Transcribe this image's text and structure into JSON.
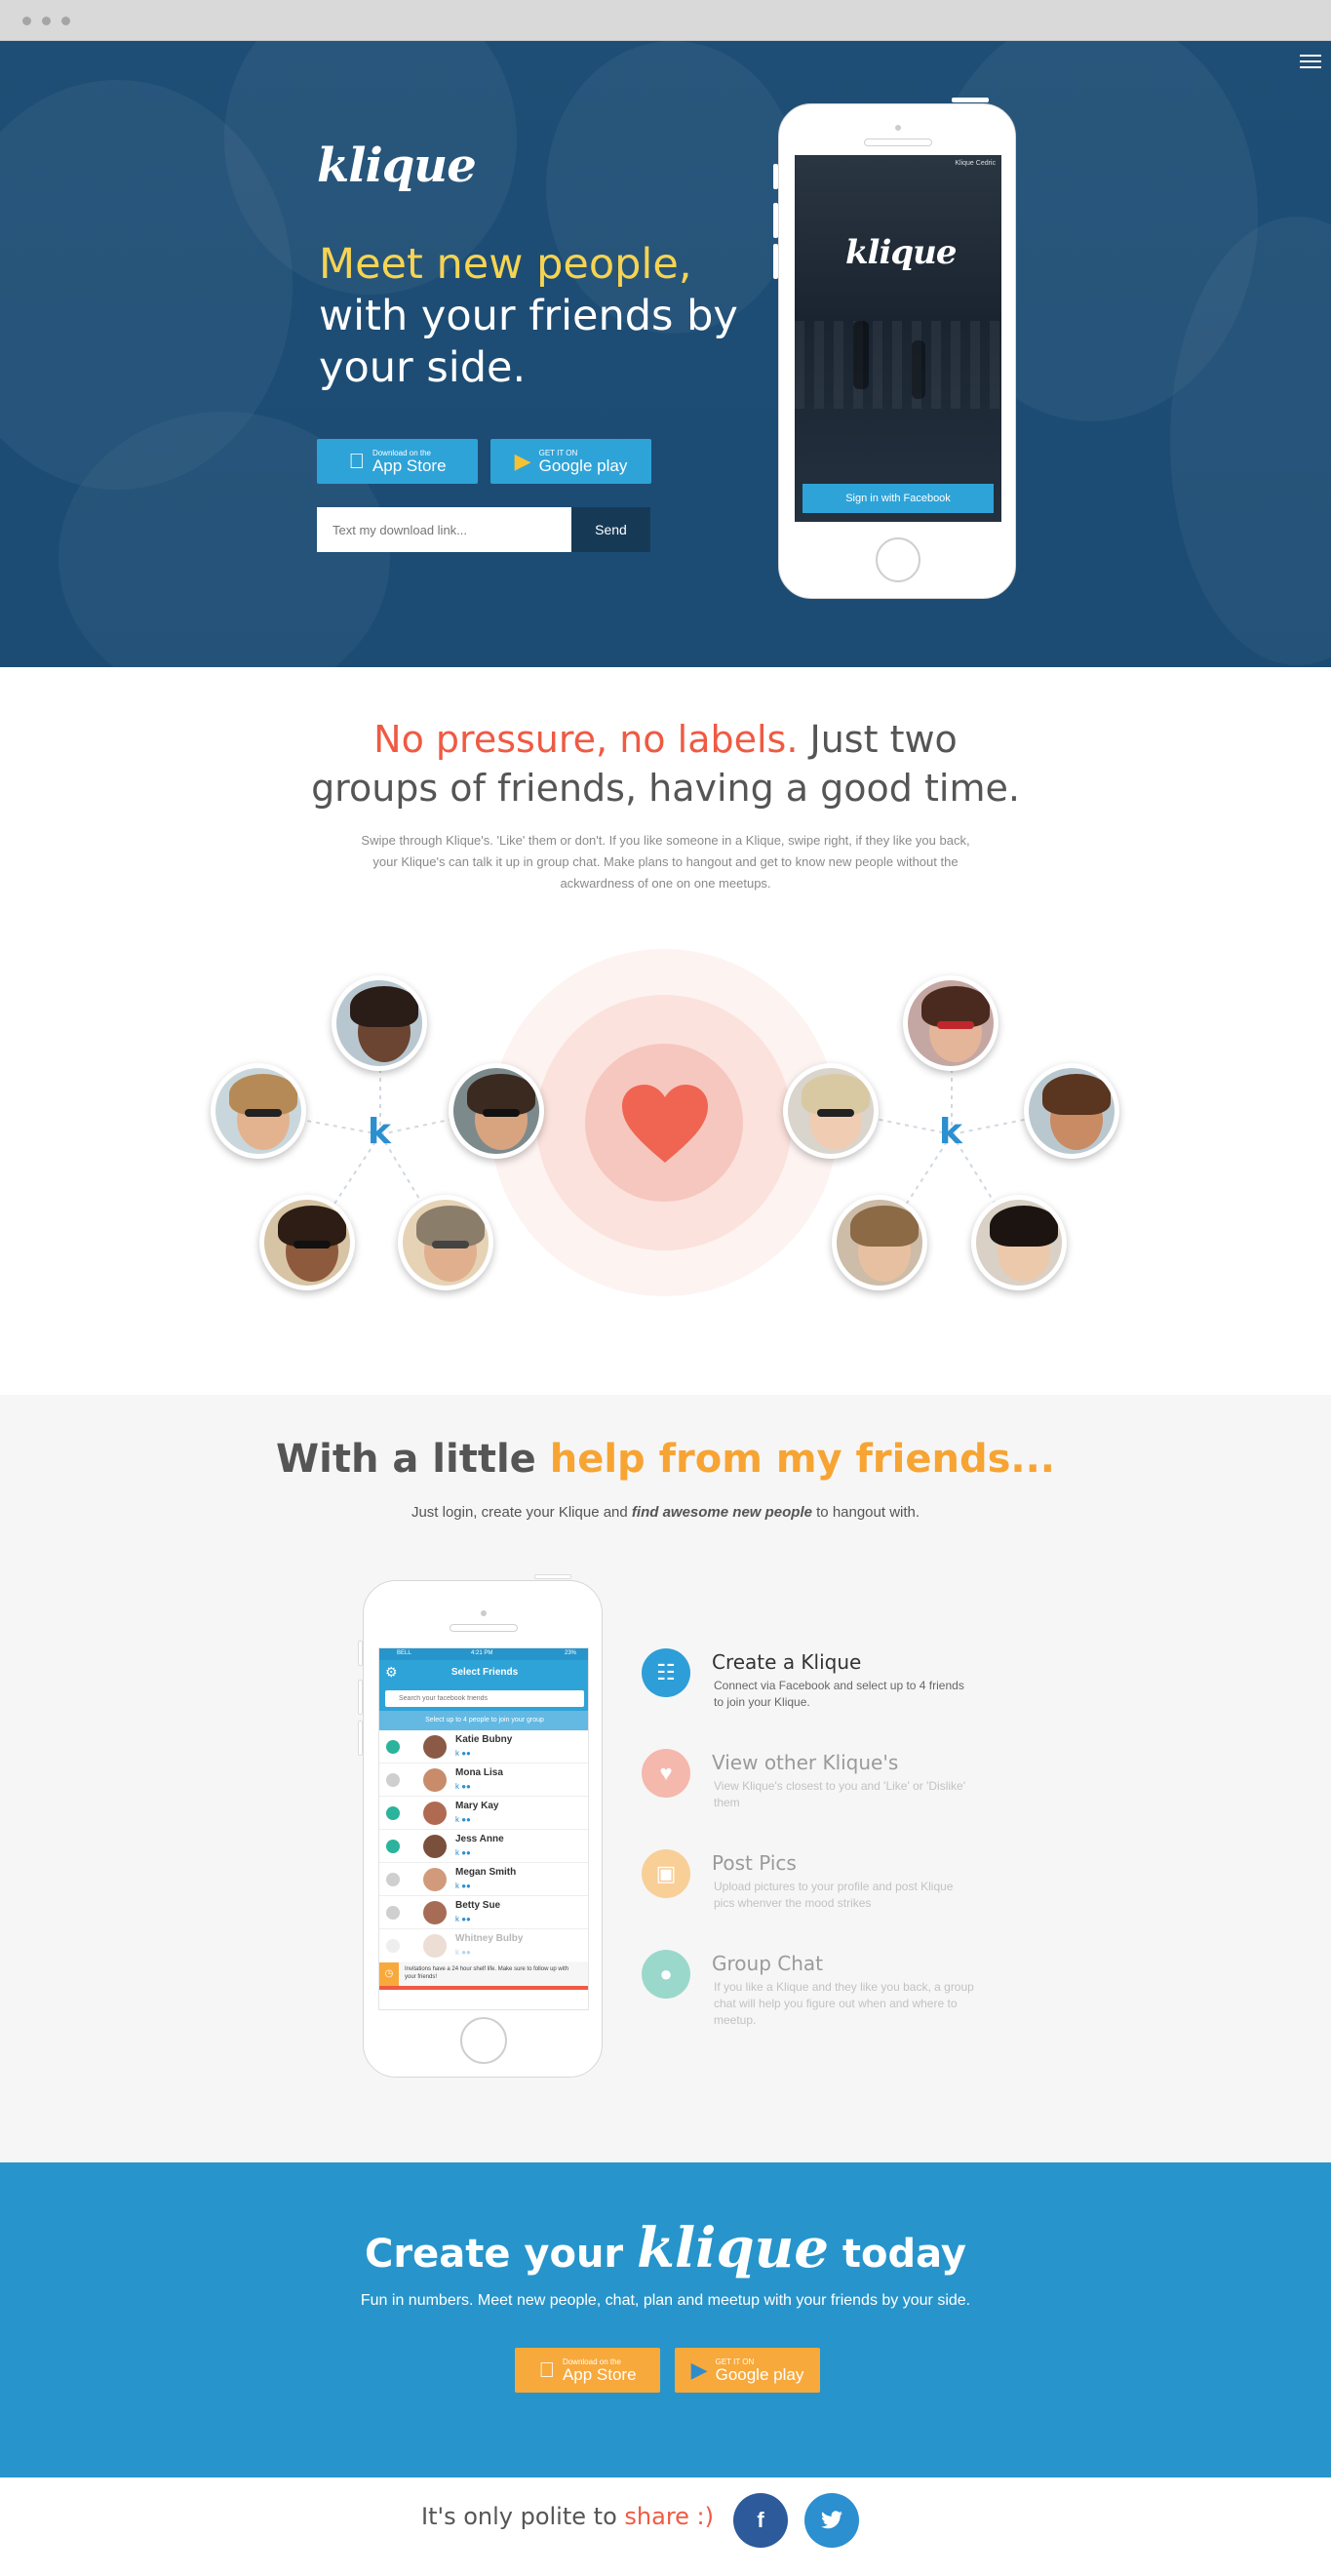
{
  "hero": {
    "logo": "klique",
    "headline_highlight": "Meet new people,",
    "headline_rest": "with your friends by your side.",
    "appstore_small": "Download on the",
    "appstore_large": "App Store",
    "googleplay_small": "GET IT ON",
    "googleplay_large": "Google play",
    "input_placeholder": "Text my download link...",
    "send_label": "Send",
    "phone": {
      "status_text": "Klique Cedric",
      "logo": "klique",
      "fb_button": "Sign in with Facebook"
    }
  },
  "intro": {
    "title_red": "No pressure, no labels.",
    "title_rest_1": "Just two",
    "title_rest_2": "groups of friends, having a good time.",
    "paragraph": "Swipe through Klique's. 'Like' them or don't.  If you like someone in a Klique, swipe right, if they like you back, your Klique's can talk it up in group chat.  Make plans to hangout and get to know new people without the ackwardness of one on one meetups.",
    "klique_mark": "k"
  },
  "features": {
    "title_plain": "With a little",
    "title_orange": "help from my friends...",
    "subtitle_before": "Just login, create your Klique and",
    "subtitle_bold": "find awesome new people",
    "subtitle_after": "to hangout with.",
    "items": [
      {
        "title": "Create a Klique",
        "desc": "Connect via Facebook and select up to 4 friends to join your Klique.",
        "icon": "group-icon",
        "color": "#2d9ed8"
      },
      {
        "title": "View other Klique's",
        "desc": "View Klique's closest to you and 'Like' or 'Dislike' them",
        "icon": "heart-icon",
        "color": "#f5b8ac"
      },
      {
        "title": "Post Pics",
        "desc": "Upload pictures to your profile and post Klique pics whenver the mood strikes",
        "icon": "picture-icon",
        "color": "#f9cf98"
      },
      {
        "title": "Group Chat",
        "desc": "If you like a Klique and they like you back, a group chat will help you figure out when and where to meetup.",
        "icon": "chat-icon",
        "color": "#9bd8cc"
      }
    ],
    "phone_screen": {
      "status_left": "BELL",
      "status_time": "4:21 PM",
      "status_right": "23%",
      "title": "Select Friends",
      "search_placeholder": "Search your facebook friends",
      "hint": "Select up to 4 people to join your group",
      "friends": [
        {
          "name": "Katie Bubny",
          "selected": true
        },
        {
          "name": "Mona Lisa",
          "selected": false
        },
        {
          "name": "Mary Kay",
          "selected": true
        },
        {
          "name": "Jess Anne",
          "selected": true
        },
        {
          "name": "Megan Smith",
          "selected": false
        },
        {
          "name": "Betty Sue",
          "selected": false
        },
        {
          "name": "Whitney Bulby",
          "selected": false
        }
      ],
      "footer_note": "Invitations have a 24 hour shelf life. Make sure to follow up with your friends!"
    }
  },
  "cta": {
    "title_before": "Create your",
    "title_logo": "klique",
    "title_after": "today",
    "subtitle": "Fun in numbers. Meet new people, chat, plan and meetup with your friends by your side.",
    "appstore_small": "Download on the",
    "appstore_large": "App Store",
    "googleplay_small": "GET IT ON",
    "googleplay_large": "Google play"
  },
  "share": {
    "text_before": "It's only polite to",
    "text_link": "share :)",
    "facebook": "f",
    "twitter": "t"
  },
  "colors": {
    "hero_blue": "#1f4f76",
    "accent_yellow": "#f6d452",
    "accent_red": "#ef5a43",
    "accent_orange": "#f7a433",
    "cta_blue": "#2795cb",
    "store_orange": "#f8a93b",
    "store_blue": "#2ea3d8"
  }
}
